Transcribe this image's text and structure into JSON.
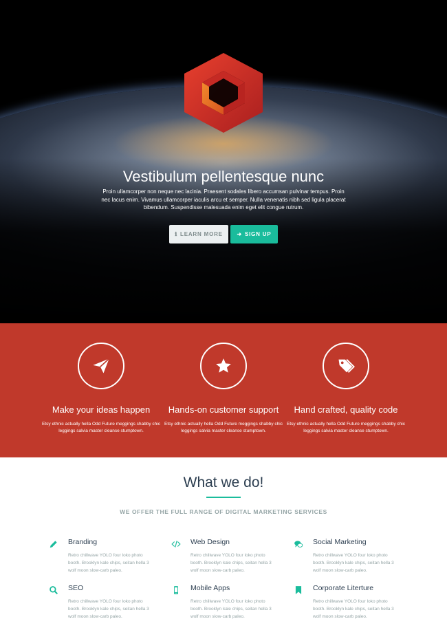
{
  "hero": {
    "title": "Vestibulum pellentesque nunc",
    "text": "Proin ullamcorper non neque nec lacinia. Praesent sodales libero accumsan pulvinar tempus. Proin nec lacus enim. Vivamus ullamcorper iaculis arcu et semper. Nulla venenatis nibh sed ligula placerat bibendum. Suspendisse malesuada enim eget elit congue rutrum.",
    "learn_more_label": "LEARN MORE",
    "sign_up_label": "SIGN UP",
    "logo_icon": "hexagon-logo-icon"
  },
  "colors": {
    "accent": "#1abc9c",
    "features_bg": "#c0392b",
    "logo_red": "#d42e2a",
    "heading": "#2c3e50",
    "muted": "#95a5a6"
  },
  "features": [
    {
      "icon": "paper-plane-icon",
      "title": "Make your ideas happen",
      "text": "Etsy ethnic actually hella Odd Future meggings shabby chic leggings salvia master cleanse stumptown."
    },
    {
      "icon": "star-icon",
      "title": "Hands-on customer support",
      "text": "Etsy ethnic actually hella Odd Future meggings shabby chic leggings salvia master cleanse stumptown."
    },
    {
      "icon": "tags-icon",
      "title": "Hand crafted, quality code",
      "text": "Etsy ethnic actually hella Odd Future meggings shabby chic leggings salvia master cleanse stumptown."
    }
  ],
  "what_we_do": {
    "title": "What we do!",
    "subtitle": "WE OFFER THE FULL RANGE OF DIGITAL MARKETING SERVICES",
    "services": [
      {
        "icon": "pencil-icon",
        "title": "Branding",
        "text": "Retro chillwave YOLO four loko photo booth. Brooklyn kale chips, seitan hella 3 wolf moon slow-carb paleo."
      },
      {
        "icon": "code-icon",
        "title": "Web Design",
        "text": "Retro chillwave YOLO four loko photo booth. Brooklyn kale chips, seitan hella 3 wolf moon slow-carb paleo."
      },
      {
        "icon": "comments-icon",
        "title": "Social Marketing",
        "text": "Retro chillwave YOLO four loko photo booth. Brooklyn kale chips, seitan hella 3 wolf moon slow-carb paleo."
      },
      {
        "icon": "search-icon",
        "title": "SEO",
        "text": "Retro chillwave YOLO four loko photo booth. Brooklyn kale chips, seitan hella 3 wolf moon slow-carb paleo."
      },
      {
        "icon": "mobile-icon",
        "title": "Mobile Apps",
        "text": "Retro chillwave YOLO four loko photo booth. Brooklyn kale chips, seitan hella 3 wolf moon slow-carb paleo."
      },
      {
        "icon": "bookmark-icon",
        "title": "Corporate Literture",
        "text": "Retro chillwave YOLO four loko photo booth. Brooklyn kale chips, seitan hella 3 wolf moon slow-carb paleo."
      }
    ]
  }
}
